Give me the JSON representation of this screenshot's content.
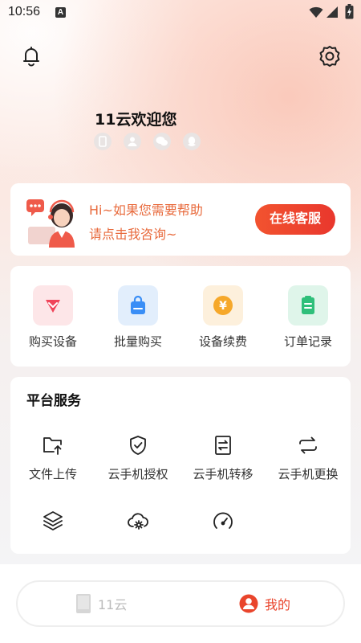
{
  "status_bar": {
    "time": "10:56",
    "notification_icon": "A"
  },
  "header": {
    "notification_icon": "bell-icon",
    "settings_icon": "gear-icon"
  },
  "profile": {
    "greeting": "11云欢迎您",
    "binding_icons": [
      "phone-icon",
      "user-icon",
      "wechat-icon",
      "qq-icon"
    ]
  },
  "help_banner": {
    "line1": "Hi~如果您需要帮助",
    "line2": "请点击我咨询~",
    "button_label": "在线客服"
  },
  "quick_actions": [
    {
      "label": "购买设备",
      "icon": "buy-device-icon",
      "color": "#f0455a"
    },
    {
      "label": "批量购买",
      "icon": "shopping-bag-icon",
      "color": "#3a8ef6"
    },
    {
      "label": "设备续费",
      "icon": "yen-coin-icon",
      "color": "#f6a82a"
    },
    {
      "label": "订单记录",
      "icon": "order-clipboard-icon",
      "color": "#2fbf7a"
    }
  ],
  "platform_services": {
    "title": "平台服务",
    "items": [
      {
        "label": "文件上传",
        "icon": "folder-upload-icon"
      },
      {
        "label": "云手机授权",
        "icon": "shield-check-icon"
      },
      {
        "label": "云手机转移",
        "icon": "transfer-icon"
      },
      {
        "label": "云手机更换",
        "icon": "swap-icon"
      },
      {
        "label": "",
        "icon": "layers-icon"
      },
      {
        "label": "",
        "icon": "cloud-settings-icon"
      },
      {
        "label": "",
        "icon": "speedometer-icon"
      }
    ]
  },
  "tabbar": {
    "tabs": [
      {
        "label": "11云",
        "icon": "cloud-phone-icon",
        "active": false
      },
      {
        "label": "我的",
        "icon": "profile-icon",
        "active": true
      }
    ],
    "accent": "#e9452c"
  }
}
